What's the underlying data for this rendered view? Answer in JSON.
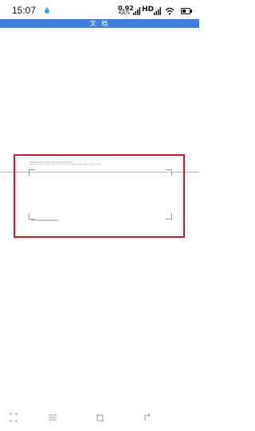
{
  "status_bar": {
    "time": "15:07",
    "network_speed": "0.92",
    "network_speed_unit": "KB/S",
    "hd_label": "HD",
    "battery_level": 0.55
  },
  "title_bar": {
    "title": "文 档"
  },
  "scanner": {
    "hint_text": "CCCCCCCCCCCCCCCCCCCCCCCCCC",
    "highlight_color": "#e0121b"
  },
  "bottom_bar": {
    "icons": [
      "scan-icon",
      "list-icon",
      "crop-icon",
      "rotate-icon"
    ]
  },
  "colors": {
    "accent": "#3e7fe0",
    "highlight": "#e0121b"
  }
}
